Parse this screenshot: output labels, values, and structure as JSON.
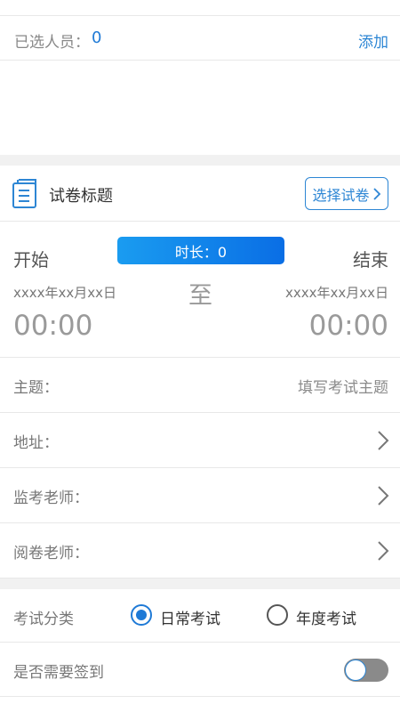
{
  "selected": {
    "label": "已选人员：",
    "count": "0",
    "add_label": "添加"
  },
  "paper": {
    "title": "试卷标题",
    "choose_label": "选择试卷",
    "icon": "document-icon"
  },
  "time": {
    "start_label": "开始",
    "end_label": "结束",
    "duration": "时长：0",
    "start_date": "xxxx年xx月xx日",
    "end_date": "xxxx年xx月xx日",
    "to": "至",
    "start_time": "00:00",
    "end_time": "00:00"
  },
  "fields": {
    "subject_label": "主题：",
    "subject_placeholder": "填写考试主题",
    "address_label": "地址：",
    "invigilator_label": "监考老师：",
    "marker_label": "阅卷老师："
  },
  "category": {
    "label": "考试分类",
    "options": [
      "日常考试",
      "年度考试"
    ],
    "selected": "日常考试"
  },
  "signin": {
    "label": "是否需要签到",
    "enabled": false
  },
  "colors": {
    "accent": "#1f7ad6",
    "link": "#2d86d4",
    "pill_start": "#1a9cf0",
    "pill_end": "#0a6ee5"
  }
}
